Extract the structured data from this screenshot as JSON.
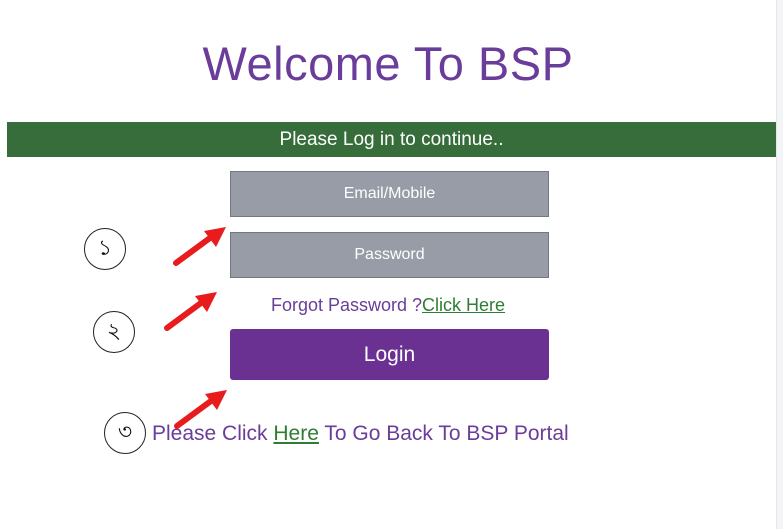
{
  "title": "Welcome To BSP",
  "banner": "Please Log in to continue..",
  "fields": {
    "email_placeholder": "Email/Mobile",
    "password_placeholder": "Password"
  },
  "forgot": {
    "prefix": "Forgot Password ?",
    "link": "Click Here"
  },
  "login_label": "Login",
  "back": {
    "prefix": "Please Click ",
    "link": "Here",
    "suffix": " To Go Back To BSP Portal"
  },
  "annotations": {
    "step1": "১",
    "step2": "২",
    "step3": "৩",
    "arrow_color": "#e81c1c"
  }
}
